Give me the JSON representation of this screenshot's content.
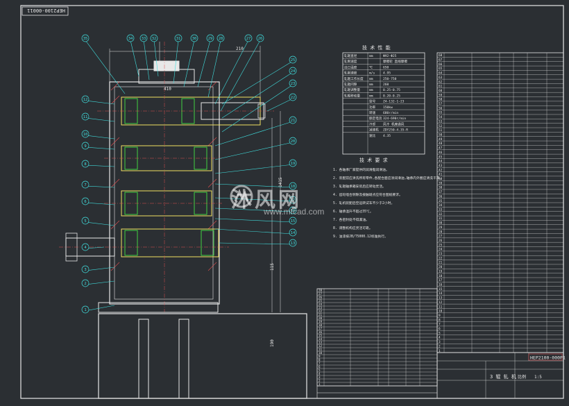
{
  "drawing": {
    "stamp_top_left": "HEP2100-00011",
    "drawing_no": "HEP2100-000P1",
    "title_block_name": "3 辊 轧 机",
    "tech_spec_title": "技 术 性 能",
    "tech_req_title": "技 术 要 求",
    "scale_label": "比例",
    "scale_value": "1:5"
  },
  "tech_spec": [
    [
      "轧辊直径",
      "mm",
      "Φ92-Φ25"
    ],
    [
      "轧制速度",
      "",
      "摩擦轮 直线摩擦"
    ],
    [
      "出口温度",
      "℃",
      "650"
    ],
    [
      "轧制速度",
      "m/s",
      "4.95"
    ],
    [
      "轧辊工作长度",
      "mm",
      "250-750"
    ],
    [
      "轧辊间隙",
      "mm",
      "260"
    ],
    [
      "轧辊调整量",
      "mm",
      "0.25-0.75"
    ],
    [
      "轧辊移动量",
      "mm",
      "0.20-0.25"
    ]
  ],
  "tech_spec_motor": [
    [
      "型号",
      "Z4-132-1-23"
    ],
    [
      "功率",
      "150kw"
    ],
    [
      "转速",
      "680r/min"
    ],
    [
      "额定电流",
      "324-690r/min"
    ],
    [
      "冷却",
      "风冷 机座通风"
    ],
    [
      "减速机",
      "ZDY250-4.35-R"
    ],
    [
      "速比",
      "4.35"
    ]
  ],
  "tech_requirements": [
    "1. 各轴承厂家提供的润滑脂润滑油。",
    "2. 装配前应清洗所有零件,各配合面应涂润滑油,轴承内外圈应清洗干净。",
    "3. 轧辊轴承箱安装后应转动灵活。",
    "4. 齿轮啮合侧隙及接触斑点应符合图纸要求。",
    "5. 轧机装配后空运转试车不少于2小时。",
    "6. 轴承温升不超过35℃。",
    "7. 各密封处不得漏油。",
    "8. 调整机构应灵活可靠。",
    "9. 油漆按JB/T5000.12标准执行。"
  ],
  "balloons": [
    "35",
    "34",
    "33",
    "32",
    "31",
    "30",
    "29",
    "28",
    "27",
    "26",
    "25",
    "24",
    "23",
    "22",
    "21",
    "20",
    "19",
    "18",
    "17",
    "16",
    "15",
    "14",
    "13",
    "12",
    "11",
    "10",
    "9",
    "8",
    "7",
    "6",
    "5",
    "4",
    "3",
    "2",
    "1"
  ],
  "dims": {
    "d1": "210",
    "d2": "410",
    "d3": "115",
    "d4": "1415",
    "d5": "370",
    "d6": "190"
  },
  "watermark": {
    "cn": "沐风网",
    "url": "www.mfcad.com"
  },
  "bom_right_rows": [
    "68",
    "67",
    "66",
    "65",
    "64",
    "63",
    "62",
    "61",
    "60",
    "59",
    "58",
    "57",
    "56",
    "55",
    "54",
    "53",
    "52",
    "51",
    "50",
    "49",
    "48",
    "47",
    "46",
    "45",
    "44",
    "43",
    "42",
    "41",
    "40",
    "39",
    "38",
    "37",
    "36",
    "35",
    "34",
    "33",
    "32",
    "31",
    "30",
    "29",
    "28",
    "27",
    "26",
    "25",
    "24",
    "23",
    "22",
    "21",
    "20",
    "19",
    "18",
    "17",
    "16",
    "15",
    "14",
    "13",
    "12",
    "11",
    "10",
    "9",
    "8",
    "7",
    "6",
    "5",
    "4",
    "3",
    "2",
    "1"
  ],
  "bom_mid_rows": [
    "28",
    "27",
    "26",
    "25",
    "24",
    "23",
    "22",
    "21",
    "20",
    "19",
    "18",
    "17",
    "16",
    "15",
    "14",
    "13",
    "12",
    "11",
    "10",
    "9",
    "8",
    "7",
    "6",
    "5",
    "4",
    "3",
    "2",
    "1"
  ]
}
